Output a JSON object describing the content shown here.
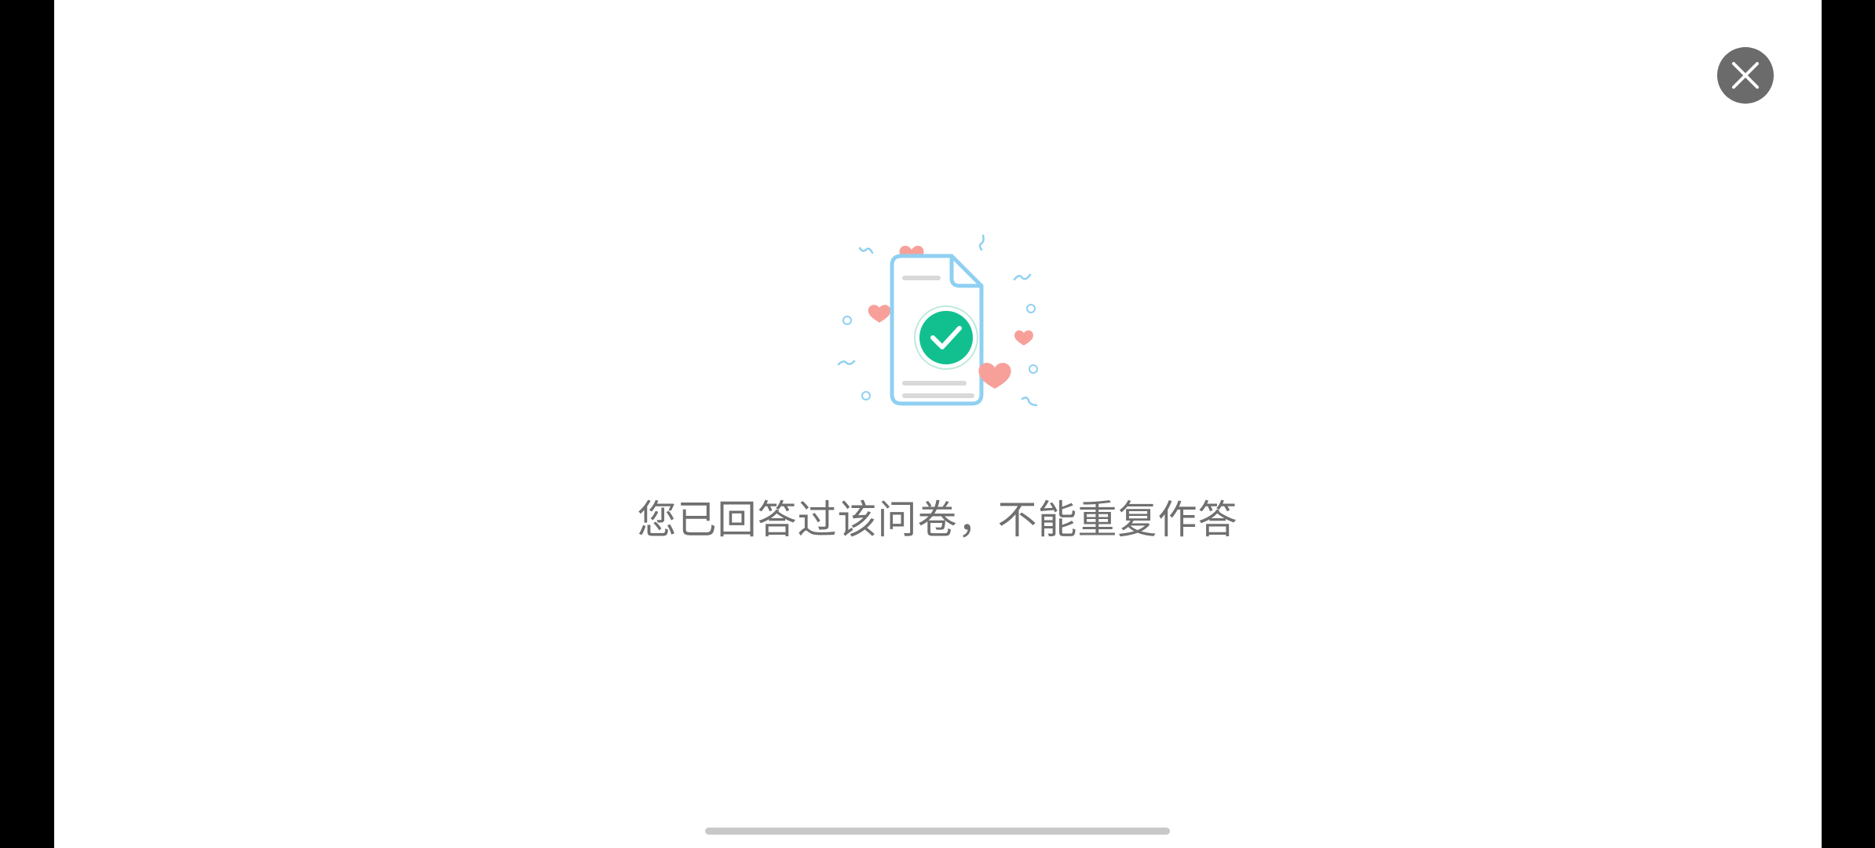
{
  "dialog": {
    "message": "您已回答过该问卷，不能重复作答",
    "close_icon": "close-icon",
    "illustration_icon": "document-check-icon"
  },
  "colors": {
    "message_text": "#6f6f6f",
    "close_button_bg": "#6b6b6b",
    "check_green": "#12c08f",
    "document_stroke": "#8fd0f2",
    "heart_pink": "#f7a09a",
    "side_bars": "#000000",
    "home_indicator": "#c8c8c8"
  }
}
